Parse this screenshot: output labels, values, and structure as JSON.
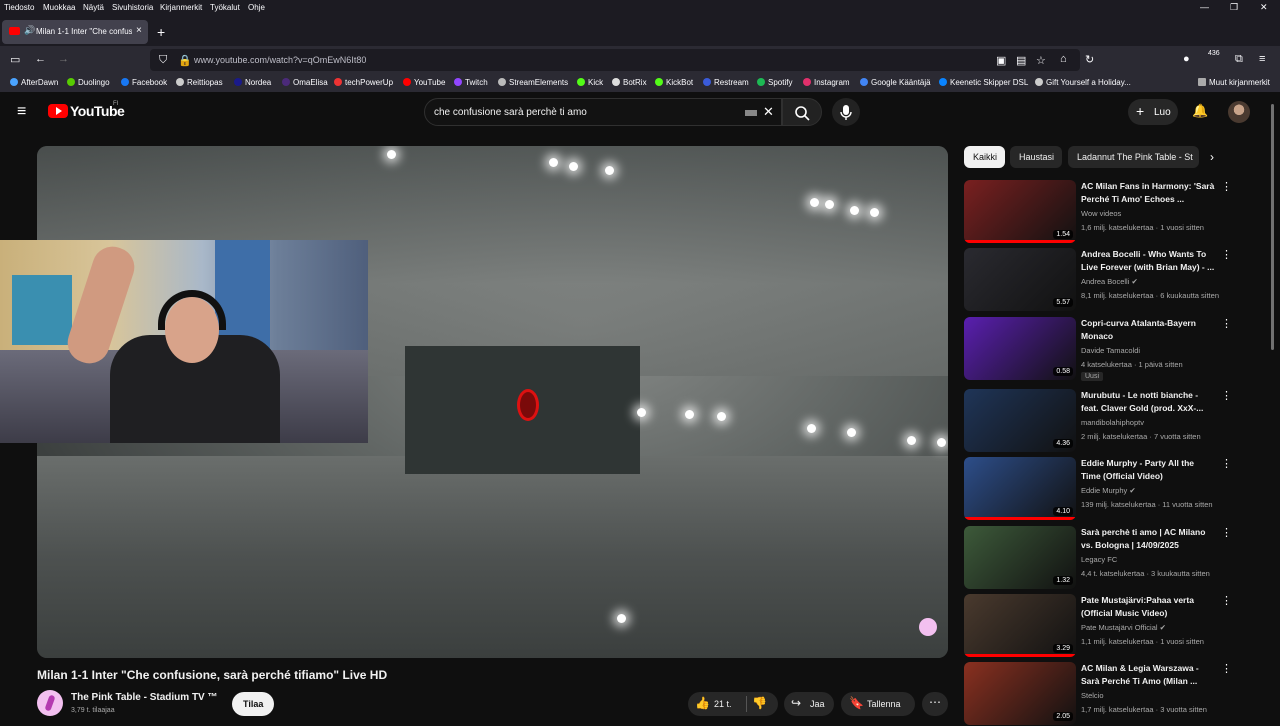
{
  "menubar": {
    "items": [
      "Tiedosto",
      "Muokkaa",
      "Näytä",
      "Sivuhistoria",
      "Kirjanmerkit",
      "Työkalut",
      "Ohje"
    ]
  },
  "tab": {
    "title": "Milan 1-1 Inter \"Che confusi",
    "close": "×"
  },
  "nav": {
    "url": "www.youtube.com/watch?v=qOmEwN6It80",
    "badge": "436"
  },
  "bookmarks": [
    "AfterDawn",
    "Duolingo",
    "Facebook",
    "Reittiopas",
    "Nordea",
    "OmaElisa",
    "techPowerUp",
    "YouTube",
    "Twitch",
    "StreamElements",
    "Kick",
    "BotRix",
    "KickBot",
    "Restream",
    "Spotify",
    "Instagram",
    "Google Kääntäjä",
    "Keenetic Skipper DSL",
    "Gift Yourself a Holiday...",
    "Muut kirjanmerkit"
  ],
  "yt": {
    "logo": "YouTube",
    "region": "FI",
    "search_query": "che confusione sarà perchè ti amo",
    "create_label": "Luo"
  },
  "video": {
    "title": "Milan 1-1 Inter \"Che confusione, sarà perché tifiamo\" Live HD",
    "channel": "The Pink Table - Stadium TV ™",
    "subscribers": "3,79 t. tilaajaa",
    "subscribe_label": "Tilaa",
    "likes": "21 t.",
    "share_label": "Jaa",
    "save_label": "Tallenna"
  },
  "chips": [
    "Kaikki",
    "Haustasi",
    "Ladannut The Pink Table - St"
  ],
  "recommendations": [
    {
      "title": "AC Milan Fans in Harmony: 'Sarà Perché Ti Amo' Echoes ...",
      "channel": "Wow videos",
      "meta": "1,6 milj. katselukertaa · 1 vuosi sitten",
      "duration": "1.54",
      "thumb": "#7a2020",
      "progress": 1.0,
      "verified": false,
      "badge": ""
    },
    {
      "title": "Andrea Bocelli - Who Wants To Live Forever (with Brian May) - ...",
      "channel": "Andrea Bocelli",
      "meta": "8,1 milj. katselukertaa · 6 kuukautta sitten",
      "duration": "5.57",
      "thumb": "#2a2a30",
      "progress": 0,
      "verified": true,
      "badge": ""
    },
    {
      "title": "Copri-curva Atalanta-Bayern Monaco",
      "channel": "Davide Tamacoldi",
      "meta": "4 katselukertaa · 1 päivä sitten",
      "duration": "0.58",
      "thumb": "#5a1fb0",
      "progress": 0,
      "verified": false,
      "badge": "Uusi"
    },
    {
      "title": "Murubutu - Le notti bianche - feat. Claver Gold (prod. XxX-...",
      "channel": "mandibolahiphoptv",
      "meta": "2 milj. katselukertaa · 7 vuotta sitten",
      "duration": "4.36",
      "thumb": "#1f3558",
      "progress": 0,
      "verified": false,
      "badge": ""
    },
    {
      "title": "Eddie Murphy - Party All the Time (Official Video)",
      "channel": "Eddie Murphy",
      "meta": "139 milj. katselukertaa · 11 vuotta sitten",
      "duration": "4.10",
      "thumb": "#2d4e8a",
      "progress": 1.0,
      "verified": true,
      "badge": ""
    },
    {
      "title": "Sarà perchè ti amo | AC Milano vs. Bologna | 14/09/2025",
      "channel": "Legacy FC",
      "meta": "4,4 t. katselukertaa · 3 kuukautta sitten",
      "duration": "1.32",
      "thumb": "#3d5a3a",
      "progress": 0,
      "verified": false,
      "badge": ""
    },
    {
      "title": "Pate Mustajärvi:Pahaa verta (Official Music Video)",
      "channel": "Pate Mustajärvi Official",
      "meta": "1,1 milj. katselukertaa · 1 vuosi sitten",
      "duration": "3.29",
      "thumb": "#4a3a2e",
      "progress": 1.0,
      "verified": true,
      "badge": ""
    },
    {
      "title": "AC Milan & Legia Warszawa - Sarà Perché Ti Amo (Milan ...",
      "channel": "Stelcio",
      "meta": "1,7 milj. katselukertaa · 3 vuotta sitten",
      "duration": "2.05",
      "thumb": "#8a3020",
      "progress": 0,
      "verified": false,
      "badge": ""
    }
  ],
  "colors": {
    "bg": "#0f0f0f",
    "accent": "#ff0000",
    "chip_active": "#f1f1f1"
  }
}
